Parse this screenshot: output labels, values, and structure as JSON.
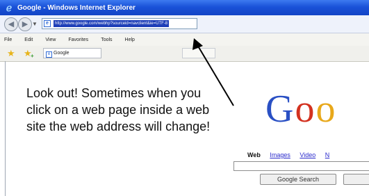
{
  "window": {
    "title": "Google - Windows Internet Explorer"
  },
  "icons": {
    "ie_logo": "ie-logo-icon",
    "back": "back-arrow-icon",
    "forward": "forward-arrow-icon",
    "favorites": "star-icon",
    "add_favorites": "add-favorites-icon",
    "page": "page-icon"
  },
  "address_bar": {
    "url": "http://www.google.com/webhp?sourceid=navclient&ie=UTF-8"
  },
  "menu": {
    "items": [
      "File",
      "Edit",
      "View",
      "Favorites",
      "Tools",
      "Help"
    ]
  },
  "tab": {
    "label": "Google"
  },
  "callout": {
    "text": "Look out!  Sometimes when you click on a web page inside a web site the web address will change!"
  },
  "google": {
    "logo_letters": [
      "G",
      "o",
      "o"
    ],
    "links": [
      "Web",
      "Images",
      "Video",
      "N"
    ],
    "search_button": "Google Search"
  },
  "colors": {
    "titlebar": "#1a52d8",
    "url_highlight": "#1e3fb8",
    "google_blue": "#2a50c4",
    "google_red": "#d3311f",
    "google_yellow": "#e8a81a"
  }
}
